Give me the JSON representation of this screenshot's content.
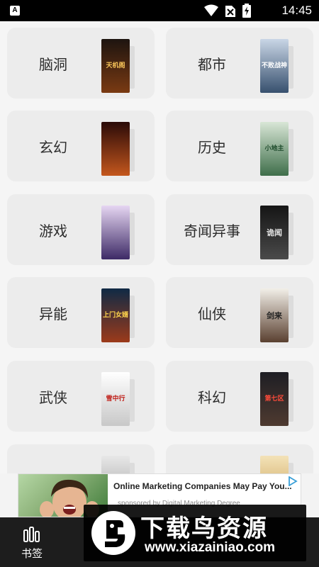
{
  "status_bar": {
    "time": "14:45"
  },
  "categories": [
    {
      "label": "脑洞",
      "cover_text": "天机阁",
      "colors": [
        "#1d1410",
        "#7a3a12"
      ],
      "text_color": "#f7c55a"
    },
    {
      "label": "都市",
      "cover_text": "不败战神",
      "colors": [
        "#c9d6e6",
        "#37506e"
      ],
      "text_color": "#ffffff"
    },
    {
      "label": "玄幻",
      "cover_text": "",
      "colors": [
        "#2a0a08",
        "#c4571d"
      ],
      "text_color": "#ffd27a"
    },
    {
      "label": "历史",
      "cover_text": "小地主",
      "colors": [
        "#d8e6d6",
        "#3f6e4a"
      ],
      "text_color": "#1f4c2d"
    },
    {
      "label": "游戏",
      "cover_text": "",
      "colors": [
        "#e6d6f2",
        "#3d2a66"
      ],
      "text_color": "#2a1a4a"
    },
    {
      "label": "奇闻异事",
      "cover_text": "诡闻",
      "colors": [
        "#151515",
        "#4a4a4a"
      ],
      "text_color": "#e6e6e6"
    },
    {
      "label": "异能",
      "cover_text": "上门女婿",
      "colors": [
        "#0f2a45",
        "#9c3a1a"
      ],
      "text_color": "#ffd54d"
    },
    {
      "label": "仙侠",
      "cover_text": "剑来",
      "colors": [
        "#f2efe8",
        "#5a4030"
      ],
      "text_color": "#222222"
    },
    {
      "label": "武侠",
      "cover_text": "雪中行",
      "colors": [
        "#ffffff",
        "#c8c8c8"
      ],
      "text_color": "#c0201a"
    },
    {
      "label": "科幻",
      "cover_text": "第七区",
      "colors": [
        "#1e1e24",
        "#4e3a30"
      ],
      "text_color": "#ff4b3a"
    },
    {
      "label": "",
      "cover_text": "",
      "colors": [
        "#e8e8e8",
        "#9a9a9a"
      ],
      "text_color": "#333333"
    },
    {
      "label": "",
      "cover_text": "",
      "colors": [
        "#f3e2b8",
        "#c59a4a"
      ],
      "text_color": "#333333"
    }
  ],
  "bottom_nav": {
    "bookshelf_label": "书签"
  },
  "ad": {
    "title": "Online Marketing Companies May Pay You...",
    "sponsor": "sponsored by Digital Marketing Degree"
  },
  "watermark": {
    "title": "下载鸟资源",
    "url": "www.xiazainiao.com"
  }
}
